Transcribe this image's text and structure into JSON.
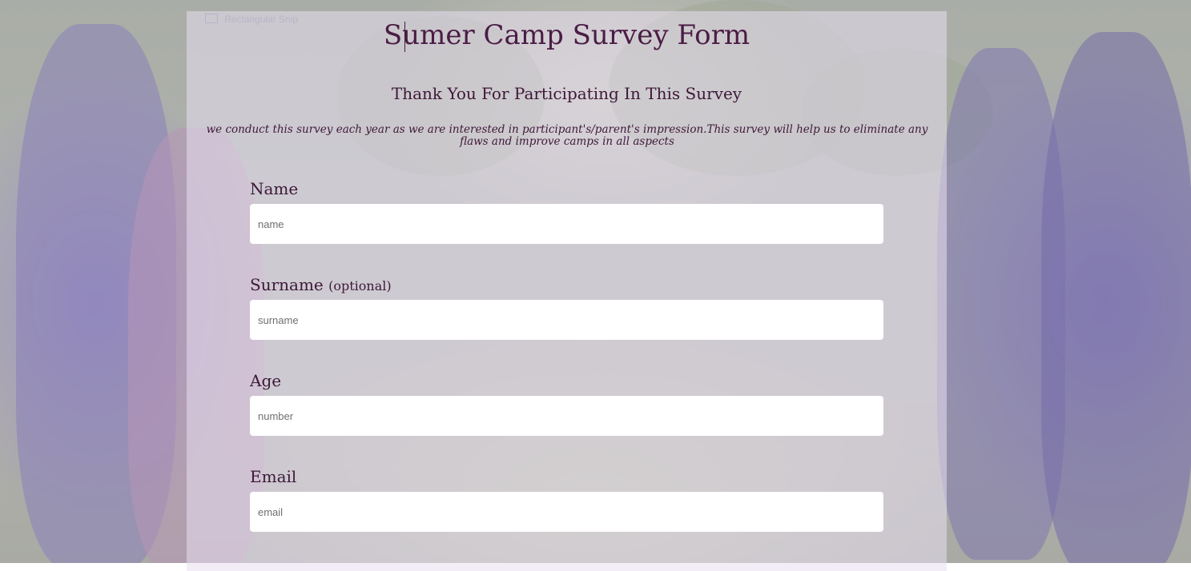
{
  "snip_overlay": {
    "label": "Rectangular Snip"
  },
  "form": {
    "title": "Sumer Camp Survey Form",
    "subtitle": "Thank You For Participating In This Survey",
    "description": "we conduct this survey each year as we are interested in participant's/parent's impression.This survey will help us to eliminate any flaws and improve camps in all aspects",
    "fields": [
      {
        "label": "Name",
        "optional_note": "",
        "placeholder": "name",
        "value": ""
      },
      {
        "label": "Surname",
        "optional_note": "(optional)",
        "placeholder": "surname",
        "value": ""
      },
      {
        "label": "Age",
        "optional_note": "",
        "placeholder": "number",
        "value": ""
      },
      {
        "label": "Email",
        "optional_note": "",
        "placeholder": "email",
        "value": ""
      }
    ]
  },
  "colors": {
    "heading": "#4a1c45",
    "text": "#3d1838",
    "panel": "#e8def0",
    "input_bg": "#ffffff"
  }
}
